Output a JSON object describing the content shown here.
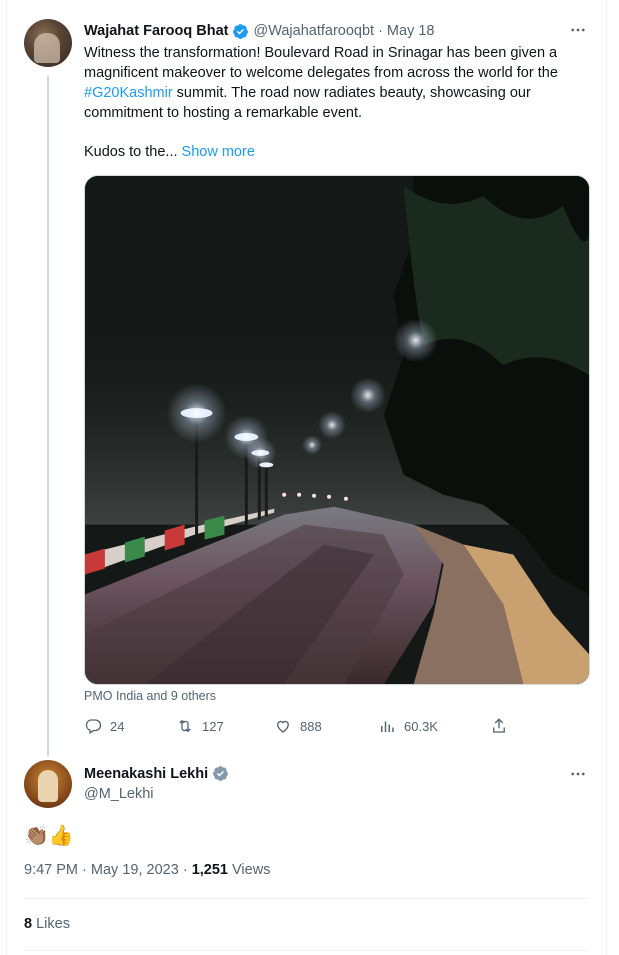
{
  "tweet1": {
    "author_name": "Wajahat Farooq Bhat",
    "handle": "@Wajahatfarooqbt",
    "separator": "·",
    "date": "May 18",
    "text_before_hashtag": "Witness the transformation! Boulevard Road in Srinagar has been given a magnificent makeover to welcome delegates from across the world for the ",
    "hashtag": "#G20Kashmir",
    "text_after_hashtag": " summit. The road now radiates beauty, showcasing our commitment to hosting a remarkable event.",
    "kudos_text": "Kudos to the...",
    "show_more": "Show more",
    "tagged": "PMO India and 9 others",
    "stats": {
      "replies": "24",
      "retweets": "127",
      "likes": "888",
      "views": "60.3K"
    }
  },
  "tweet2": {
    "author_name": "Meenakashi Lekhi",
    "handle": "@M_Lekhi",
    "text": "👏🏽👍",
    "time": "9:47 PM",
    "separator": "·",
    "date": "May 19, 2023",
    "views_count": "1,251",
    "views_label": "Views",
    "likes_count": "8",
    "likes_label": "Likes"
  },
  "icons": {
    "verified": "verified-badge-icon",
    "more": "more-options-icon",
    "reply": "reply-icon",
    "retweet": "retweet-icon",
    "like": "heart-icon",
    "views": "analytics-icon",
    "share": "share-icon"
  },
  "colors": {
    "accent": "#1d9bf0",
    "text": "#0f1419",
    "muted": "#536471",
    "border": "#cfd9de",
    "thread_line": "#cfd9de"
  }
}
